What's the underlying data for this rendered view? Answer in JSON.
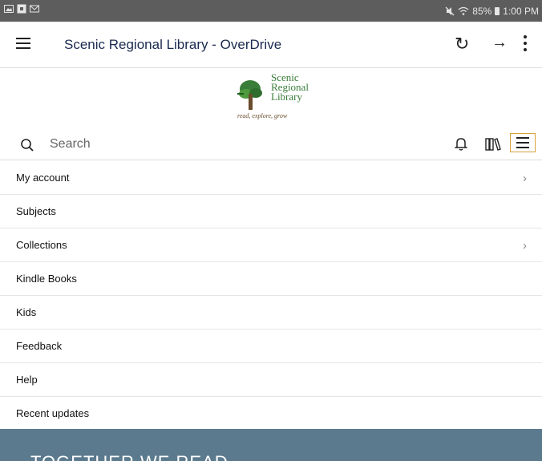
{
  "statusbar": {
    "right_text": "85%",
    "time": "1:00 PM",
    "icons": [
      "image-icon",
      "flipboard-icon",
      "mail-icon",
      "mute-icon",
      "wifi-icon",
      "battery-icon"
    ]
  },
  "topbar": {
    "title": "Scenic Regional Library - OverDrive",
    "icons": [
      "hamburger-icon",
      "refresh-icon",
      "forward-icon",
      "more-vert-icon"
    ]
  },
  "logo": {
    "line1": "Scenic",
    "line2": "Regional",
    "line3": "Library",
    "tagline": "read, explore, grow"
  },
  "search": {
    "placeholder": "Search",
    "icons": [
      "search-icon",
      "bell-icon",
      "bookshelf-icon",
      "menu-icon"
    ]
  },
  "menu": {
    "items": [
      {
        "label": "My account"
      },
      {
        "label": "Subjects"
      },
      {
        "label": "Collections"
      },
      {
        "label": "Kindle Books"
      },
      {
        "label": "Kids"
      },
      {
        "label": "Feedback"
      },
      {
        "label": "Help"
      },
      {
        "label": "Recent updates"
      }
    ]
  },
  "banner": {
    "text": "TOGETHER WE READ"
  },
  "colors": {
    "statusbar": "#5d5d5d",
    "title": "#1a2a4e",
    "logo_green": "#3a7d3a",
    "banner": "#5b7a8e",
    "menu_button_border": "#d8a23e"
  }
}
